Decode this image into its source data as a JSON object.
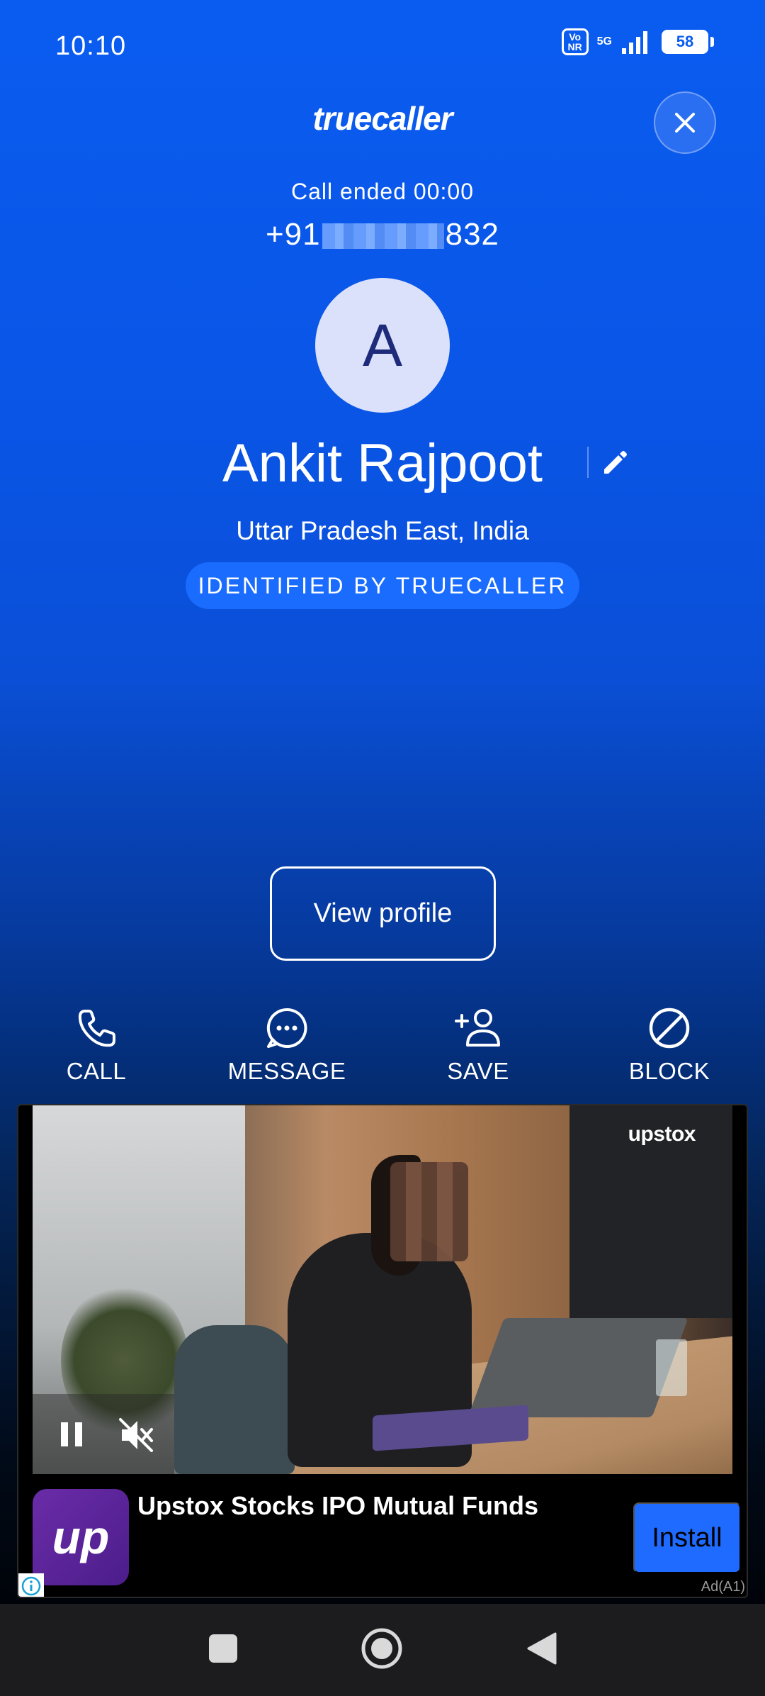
{
  "status_bar": {
    "time": "10:10",
    "volte": "Vo\nNR",
    "network": "5G",
    "battery": "58"
  },
  "header": {
    "brand": "truecaller",
    "close_icon": "close-icon"
  },
  "caller": {
    "call_status": "Call ended 00:00",
    "phone_prefix": "+91",
    "phone_suffix": "832",
    "avatar_initial": "A",
    "name": "Ankit Rajpoot",
    "location": "Uttar Pradesh East, India",
    "badge": "IDENTIFIED BY TRUECALLER"
  },
  "view_profile_label": "View profile",
  "actions": [
    {
      "label": "CALL",
      "icon": "phone-icon"
    },
    {
      "label": "MESSAGE",
      "icon": "message-icon"
    },
    {
      "label": "SAVE",
      "icon": "add-person-icon"
    },
    {
      "label": "BLOCK",
      "icon": "block-icon"
    }
  ],
  "ad": {
    "video_brand": "upstox",
    "app_icon_text": "up",
    "title": "Upstox Stocks IPO Mutual Funds",
    "install_label": "Install",
    "ad_label": "Ad(A1)"
  },
  "colors": {
    "accent": "#0a5cf0",
    "badge": "#1a6cff",
    "install": "#1f6aff"
  }
}
